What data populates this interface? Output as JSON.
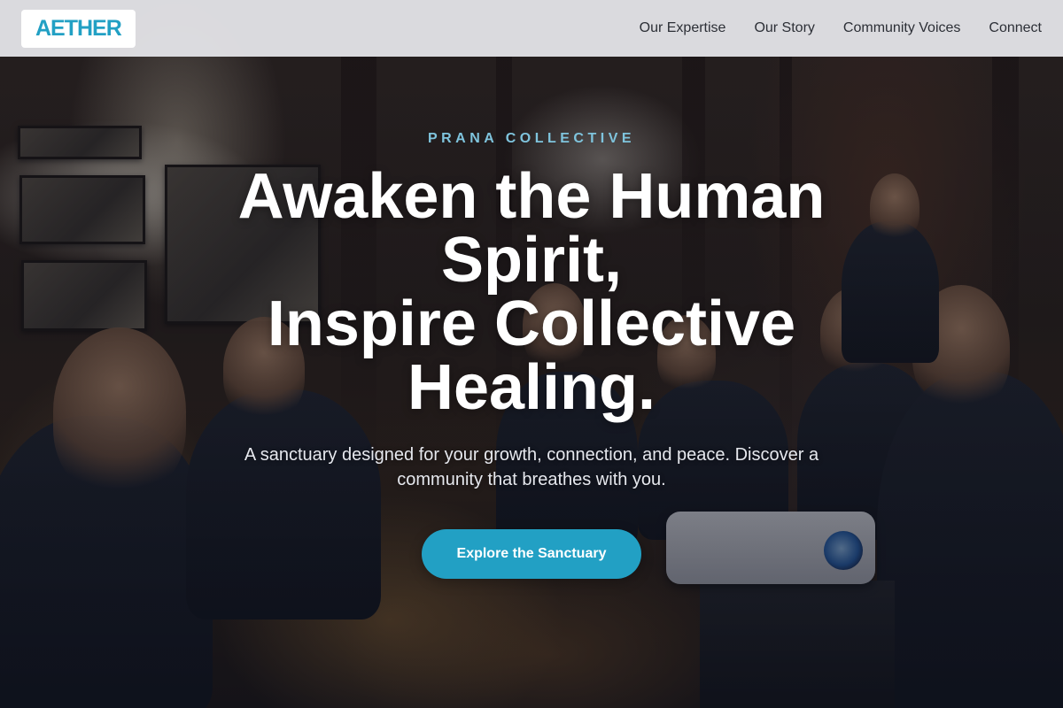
{
  "header": {
    "logo_text": "AETHER",
    "nav": [
      {
        "label": "Our Expertise"
      },
      {
        "label": "Our Story"
      },
      {
        "label": "Community Voices"
      },
      {
        "label": "Connect"
      }
    ]
  },
  "hero": {
    "eyebrow": "PRANA COLLECTIVE",
    "headline_line1": "Awaken the Human Spirit,",
    "headline_line2": "Inspire Collective Healing.",
    "subtext": "A sanctuary designed for your growth, connection, and peace. Discover a community that breathes with you.",
    "cta_label": "Explore the Sanctuary",
    "background_image": "photo of people seated in a warmly lit wooden room with a projector"
  },
  "colors": {
    "accent": "#22a0c4",
    "eyebrow": "#7fc4dd",
    "header_bg": "#e2e2e6",
    "nav_text": "#2c2f36",
    "headline": "#ffffff"
  }
}
